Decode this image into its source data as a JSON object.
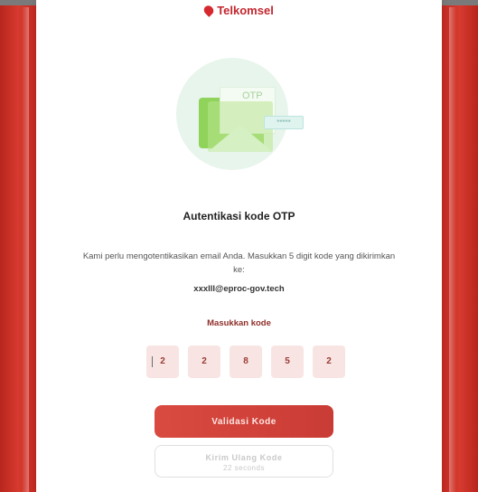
{
  "brand": {
    "logo_text": "Telkomsel",
    "accent": "#c4262e",
    "frame_color": "#c42a22"
  },
  "illustration": {
    "otp_label": "OTP",
    "password_mask": "*****"
  },
  "auth": {
    "title": "Autentikasi kode OTP",
    "description": "Kami perlu mengotentikasikan email Anda. Masukkan 5 digit kode yang dikirimkan ke:",
    "email": "xxxlll@eproc-gov.tech",
    "code_label": "Masukkan kode"
  },
  "otp_digits": [
    "2",
    "2",
    "8",
    "5",
    "2"
  ],
  "buttons": {
    "validate_label": "Validasi Kode",
    "resend_label": "Kirim Ulang Kode",
    "resend_countdown": "22 seconds"
  }
}
